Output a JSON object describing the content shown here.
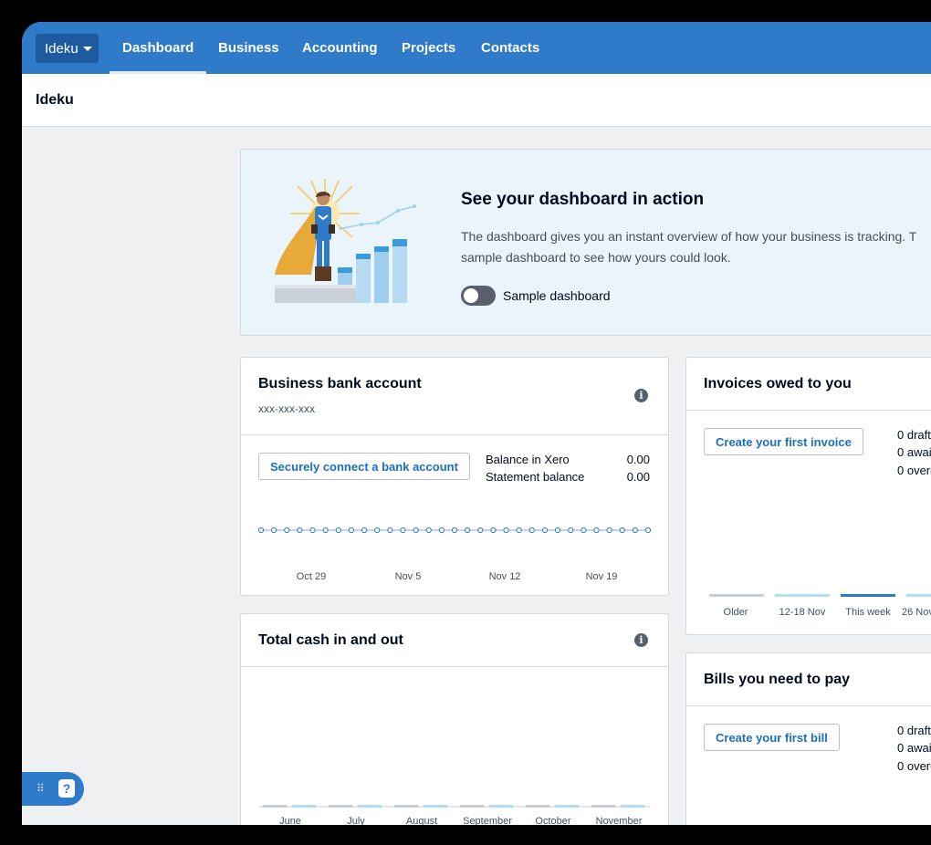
{
  "nav": {
    "org_button": "Ideku",
    "tabs": [
      "Dashboard",
      "Business",
      "Accounting",
      "Projects",
      "Contacts"
    ]
  },
  "title": "Ideku",
  "promo": {
    "title": "See your dashboard in action",
    "body_line1": "The dashboard gives you an instant overview of how your business is tracking. T",
    "body_line2": "sample dashboard to see how yours could look.",
    "toggle_label": "Sample dashboard"
  },
  "bank_card": {
    "title": "Business bank account",
    "account_number": "xxx-xxx-xxx",
    "connect_button": "Securely connect a bank account",
    "balance_xero_label": "Balance in Xero",
    "balance_xero_value": "0.00",
    "statement_label": "Statement balance",
    "statement_value": "0.00",
    "dates": [
      "Oct 29",
      "Nov 5",
      "Nov 12",
      "Nov 19"
    ]
  },
  "invoices_card": {
    "title": "Invoices owed to you",
    "button": "Create your first invoice",
    "stats": [
      "0 draft",
      "0 awai",
      "0 overc"
    ],
    "buckets": [
      "Older",
      "12-18 Nov",
      "This week",
      "26 Nov"
    ]
  },
  "cash_card": {
    "title": "Total cash in and out",
    "months": [
      "June",
      "July",
      "August",
      "September",
      "October",
      "November"
    ]
  },
  "bills_card": {
    "title": "Bills you need to pay",
    "button": "Create your first bill",
    "stats": [
      "0 draft",
      "0 awai",
      "0 overc"
    ]
  },
  "colors": {
    "nav_blue": "#2f7ac9",
    "link_blue": "#1c6fbf",
    "promo_bg": "#eaf4fb"
  }
}
